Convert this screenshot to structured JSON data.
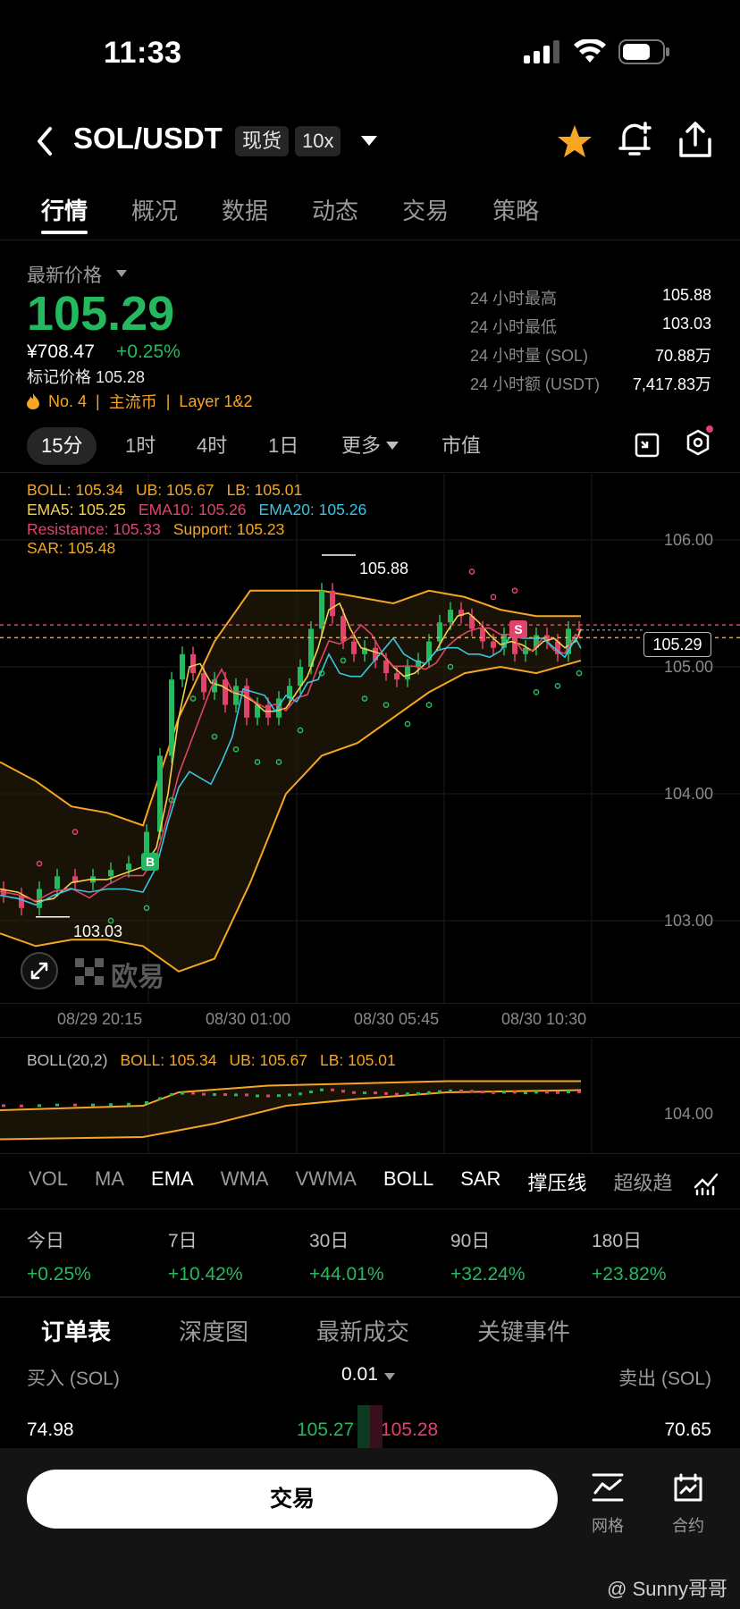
{
  "status": {
    "time": "11:33"
  },
  "header": {
    "pair": "SOL/USDT",
    "tag_spot": "现货",
    "tag_leverage": "10x"
  },
  "tabs": [
    "行情",
    "概况",
    "数据",
    "动态",
    "交易",
    "策略"
  ],
  "price": {
    "label": "最新价格",
    "last": "105.29",
    "cny": "¥708.47",
    "change": "+0.25%",
    "mark": "标记价格 105.28",
    "rank": "No. 4",
    "category": "主流币",
    "layer": "Layer 1&2"
  },
  "stats": [
    {
      "label": "24 小时最高",
      "value": "105.88"
    },
    {
      "label": "24 小时最低",
      "value": "103.03"
    },
    {
      "label": "24 小时量 (SOL)",
      "value": "70.88万"
    },
    {
      "label": "24 小时额 (USDT)",
      "value": "7,417.83万"
    }
  ],
  "timeframes": [
    "15分",
    "1时",
    "4时",
    "1日",
    "更多",
    "市值"
  ],
  "indicators": {
    "boll": "BOLL: 105.34",
    "ub": "UB: 105.67",
    "lb": "LB: 105.01",
    "ema5": "EMA5: 105.25",
    "ema10": "EMA10: 105.26",
    "ema20": "EMA20: 105.26",
    "resistance": "Resistance: 105.33",
    "support": "Support: 105.23",
    "sar": "SAR: 105.48"
  },
  "chart_data": {
    "type": "candlestick",
    "y_ticks": [
      "106.00",
      "105.00",
      "104.00",
      "103.00"
    ],
    "ylim": [
      102.7,
      106.2
    ],
    "x_ticks": [
      "08/29 20:15",
      "08/30 01:00",
      "08/30 05:45",
      "08/30 10:30"
    ],
    "high_label": "105.88",
    "low_label": "103.03",
    "current_price": "105.29",
    "marker_buy": "B",
    "marker_sell": "S",
    "colors": {
      "up": "#25b95f",
      "down": "#e0436b",
      "boll": "#f5a623",
      "ema5": "#f5d04a",
      "ema10": "#e0436b",
      "ema20": "#38c5e0"
    }
  },
  "brand": "欧易",
  "sub_indicator": {
    "name": "BOLL(20,2)",
    "boll": "BOLL: 105.34",
    "ub": "UB: 105.67",
    "lb": "LB: 105.01",
    "y_tick": "104.00"
  },
  "indicator_tabs": [
    "VOL",
    "MA",
    "EMA",
    "WMA",
    "VWMA",
    "BOLL",
    "SAR",
    "撑压线",
    "超级趋"
  ],
  "performance": [
    {
      "label": "今日",
      "value": "+0.25%"
    },
    {
      "label": "7日",
      "value": "+10.42%"
    },
    {
      "label": "30日",
      "value": "+44.01%"
    },
    {
      "label": "90日",
      "value": "+32.24%"
    },
    {
      "label": "180日",
      "value": "+23.82%"
    }
  ],
  "orderbook": {
    "tabs": [
      "订单表",
      "深度图",
      "最新成交",
      "关键事件"
    ],
    "buy_label": "买入 (SOL)",
    "precision": "0.01",
    "sell_label": "卖出 (SOL)",
    "row": {
      "buy_qty": "74.98",
      "bid": "105.27",
      "ask": "105.28",
      "sell_qty": "70.65"
    }
  },
  "bottom": {
    "trade": "交易",
    "grid": "网格",
    "contract": "合约"
  },
  "watermark": "@ Sunny哥哥"
}
